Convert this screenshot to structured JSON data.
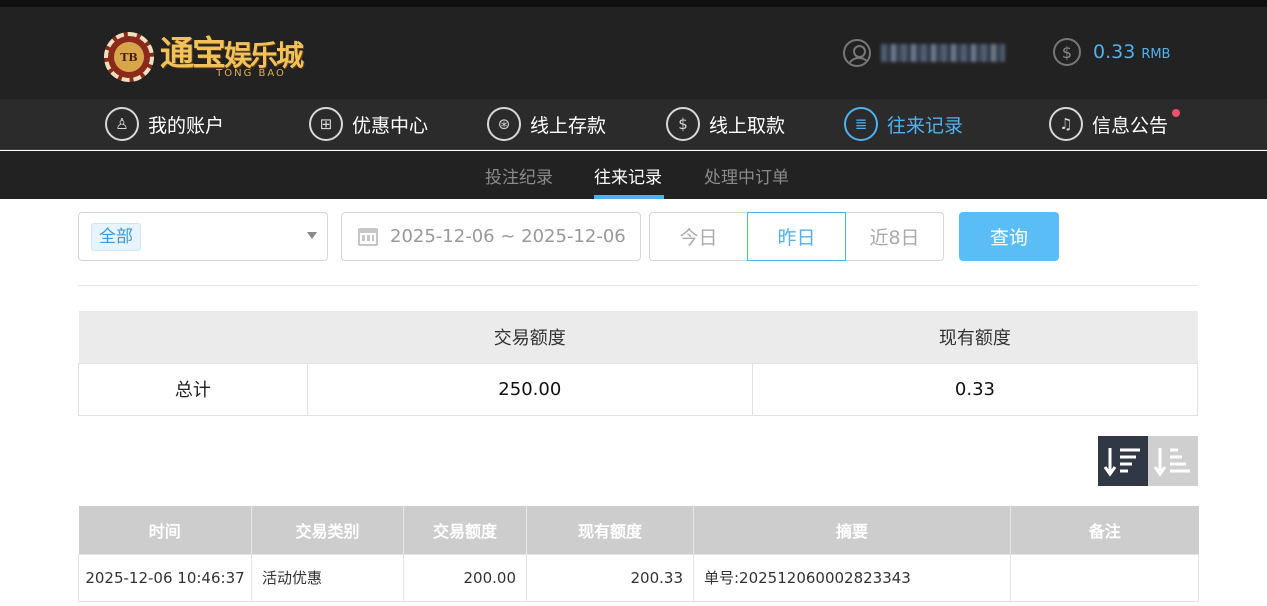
{
  "header": {
    "logo": {
      "chip_text": "TB",
      "cn_part1": "通宝",
      "cn_part2": "娱乐城",
      "en": "TONG BAO"
    },
    "balance": {
      "value": "0.33",
      "currency": "RMB"
    },
    "icons": {
      "user": "user-icon",
      "balance": "dollar-coin-icon"
    }
  },
  "nav": {
    "items": [
      {
        "label": "我的账户",
        "icon": "user-circle-icon",
        "glyph": "♙"
      },
      {
        "label": "优惠中心",
        "icon": "gift-icon",
        "glyph": "⊞"
      },
      {
        "label": "线上存款",
        "icon": "deposit-icon",
        "glyph": "⊛"
      },
      {
        "label": "线上取款",
        "icon": "withdraw-icon",
        "glyph": "$"
      },
      {
        "label": "往来记录",
        "icon": "records-icon",
        "glyph": "≣"
      },
      {
        "label": "信息公告",
        "icon": "bell-icon",
        "glyph": "♫"
      }
    ],
    "active_index": 4
  },
  "subnav": {
    "items": [
      "投注纪录",
      "往来记录",
      "处理中订单"
    ],
    "active_index": 1
  },
  "filter": {
    "type_selected": "全部",
    "date_range": "2025-12-06 ~ 2025-12-06",
    "quick": [
      "今日",
      "昨日",
      "近8日"
    ],
    "quick_active_index": 1,
    "query_label": "查询"
  },
  "summary": {
    "headers": [
      "",
      "交易额度",
      "现有额度"
    ],
    "row_label": "总计",
    "transaction_amount": "250.00",
    "current_amount": "0.33"
  },
  "records": {
    "headers": [
      "时间",
      "交易类别",
      "交易额度",
      "现有额度",
      "摘要",
      "备注"
    ],
    "rows": [
      {
        "time": "2025-12-06 10:46:37",
        "type": "活动优惠",
        "amount": "200.00",
        "balance": "200.33",
        "summary": "单号:202512060002823343",
        "note": ""
      }
    ]
  },
  "colors": {
    "accent": "#4fb1ee",
    "header_bg": "#222222",
    "nav_bg": "#2b2b2b",
    "query_button": "#5bbdf5",
    "notice_dot": "#f0506e"
  }
}
